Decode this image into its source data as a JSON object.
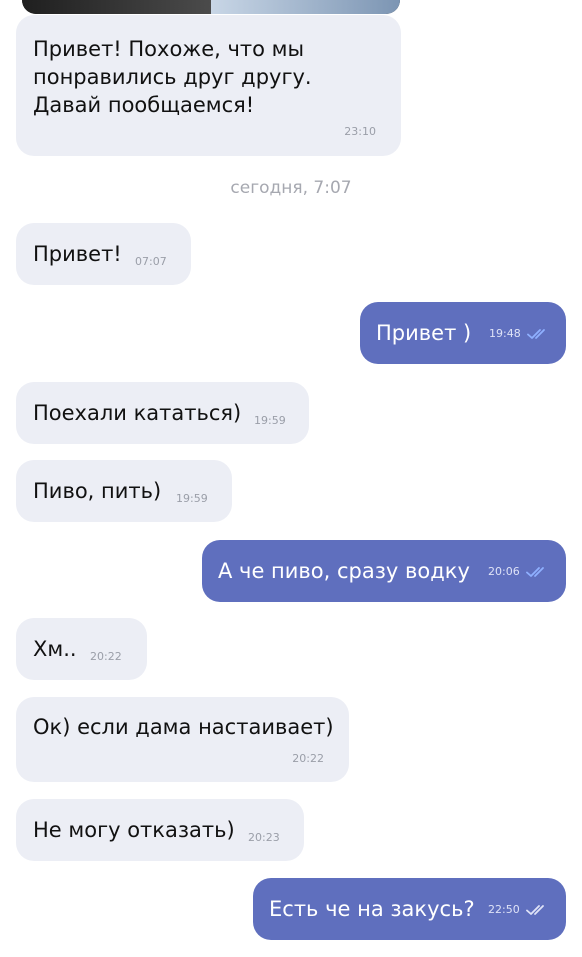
{
  "date_separator": "сегодня, 7:07",
  "colors": {
    "incoming_bubble": "#eceef5",
    "outgoing_bubble": "#5f6fbe",
    "read_check": "#8fb0ff"
  },
  "messages": [
    {
      "direction": "in",
      "text": "Привет! Похоже, что мы\nпонравились друг другу.\nДавай пообщаемся!",
      "time": "23:10"
    },
    {
      "direction": "in",
      "text": "Привет!",
      "time": "07:07"
    },
    {
      "direction": "out",
      "text": "Привет )",
      "time": "19:48",
      "status": "read-double-check-icon"
    },
    {
      "direction": "in",
      "text": "Поехали кататься)",
      "time": "19:59"
    },
    {
      "direction": "in",
      "text": "Пиво, пить)",
      "time": "19:59"
    },
    {
      "direction": "out",
      "text": "А че пиво, сразу водку",
      "time": "20:06",
      "status": "read-double-check-icon"
    },
    {
      "direction": "in",
      "text": "Хм..",
      "time": "20:22"
    },
    {
      "direction": "in",
      "text": "Ок) если дама настаивает)",
      "time": "20:22"
    },
    {
      "direction": "in",
      "text": "Не могу отказать)",
      "time": "20:23"
    },
    {
      "direction": "out",
      "text": "Есть че на закусь?",
      "time": "22:50",
      "status": "read-double-check-icon"
    }
  ]
}
